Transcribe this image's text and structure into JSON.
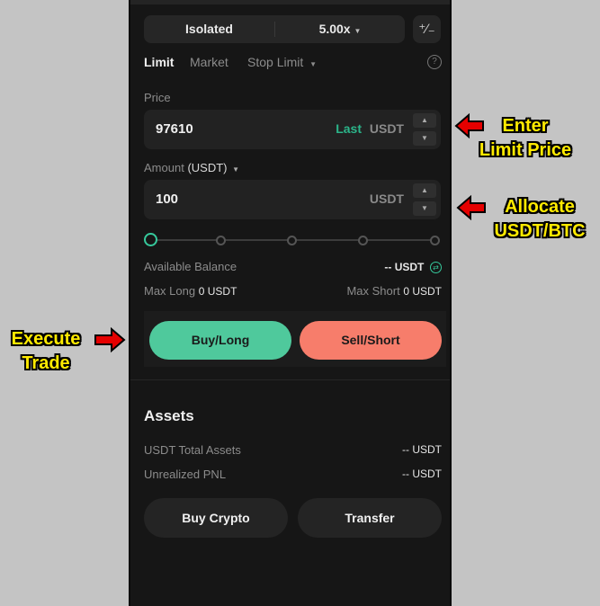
{
  "margin": {
    "mode": "Isolated",
    "leverage": "5.00x"
  },
  "order_tabs": {
    "limit": "Limit",
    "market": "Market",
    "stop_limit": "Stop Limit"
  },
  "price": {
    "label": "Price",
    "value": "97610",
    "last": "Last",
    "unit": "USDT"
  },
  "amount": {
    "label": "Amount",
    "unit_label": "(USDT)",
    "value": "100",
    "unit": "USDT"
  },
  "slider": {
    "level": 0
  },
  "balance": {
    "available_label": "Available Balance",
    "available_value": "-- USDT",
    "max_long_label": "Max Long",
    "max_long_value": "0 USDT",
    "max_short_label": "Max Short",
    "max_short_value": "0 USDT"
  },
  "buttons": {
    "buy": "Buy/Long",
    "sell": "Sell/Short",
    "buy_crypto": "Buy Crypto",
    "transfer": "Transfer"
  },
  "assets": {
    "title": "Assets",
    "total_label": "USDT Total Assets",
    "total_value": "-- USDT",
    "pnl_label": "Unrealized PNL",
    "pnl_value": "-- USDT"
  },
  "annotations": {
    "price_line1": "Enter",
    "price_line2": "Limit Price",
    "amount_line1": "Allocate",
    "amount_line2": "USDT/BTC",
    "trade_line1": "Execute",
    "trade_line2": "Trade"
  },
  "colors": {
    "buy": "#4fc99c",
    "sell": "#f77d6b",
    "accent": "#2bb58a",
    "callout_text": "#ffea00",
    "callout_arrow": "#e50000"
  },
  "icons": [
    "chevron-down-icon",
    "calculator-icon",
    "help-icon",
    "chevron-up-icon",
    "swap-icon",
    "arrow-left-icon",
    "arrow-right-icon"
  ]
}
